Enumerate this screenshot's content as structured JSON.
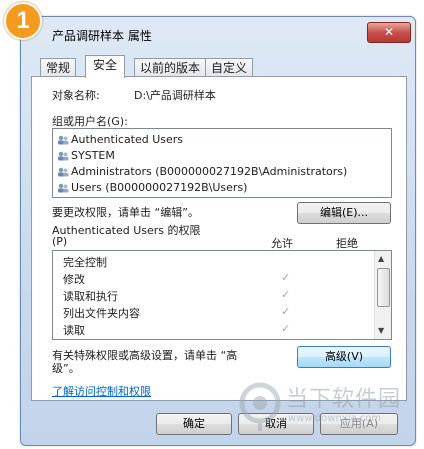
{
  "step_badge": "1",
  "window": {
    "title": "产品调研样本 属性",
    "close_glyph": "✕"
  },
  "tabs": [
    {
      "label": "常规"
    },
    {
      "label": "安全"
    },
    {
      "label": "以前的版本"
    },
    {
      "label": "自定义"
    }
  ],
  "object": {
    "label": "对象名称:",
    "value": "D:\\产品调研样本"
  },
  "groups": {
    "label": "组或用户名(G):",
    "items": [
      "Authenticated Users",
      "SYSTEM",
      "Administrators (B000000027192B\\Administrators)",
      "Users (B000000027192B\\Users)"
    ]
  },
  "edit": {
    "hint": "要更改权限，请单击 “编辑”。",
    "button": "编辑(E)..."
  },
  "permissions": {
    "header_line1": "Authenticated Users 的权限",
    "header_line2": "(P)",
    "allow_label": "允许",
    "deny_label": "拒绝",
    "rows": [
      {
        "name": "完全控制",
        "allow": ""
      },
      {
        "name": "修改",
        "allow": "✓"
      },
      {
        "name": "读取和执行",
        "allow": "✓"
      },
      {
        "name": "列出文件夹内容",
        "allow": "✓"
      },
      {
        "name": "读取",
        "allow": "✓"
      }
    ]
  },
  "advanced": {
    "hint_line1": "有关特殊权限或高级设置，请单击 “高",
    "hint_line2": "级”。",
    "button": "高级(V)"
  },
  "learn_link": "了解访问控制和权限",
  "footer": {
    "ok": "确定",
    "cancel": "取消",
    "apply": "应用(A)"
  },
  "watermark": {
    "text": "当下软件园",
    "url": "www.downxia.com"
  },
  "colors": {
    "badge": "#f39a1f",
    "link": "#0066cc",
    "close": "#c75050"
  }
}
